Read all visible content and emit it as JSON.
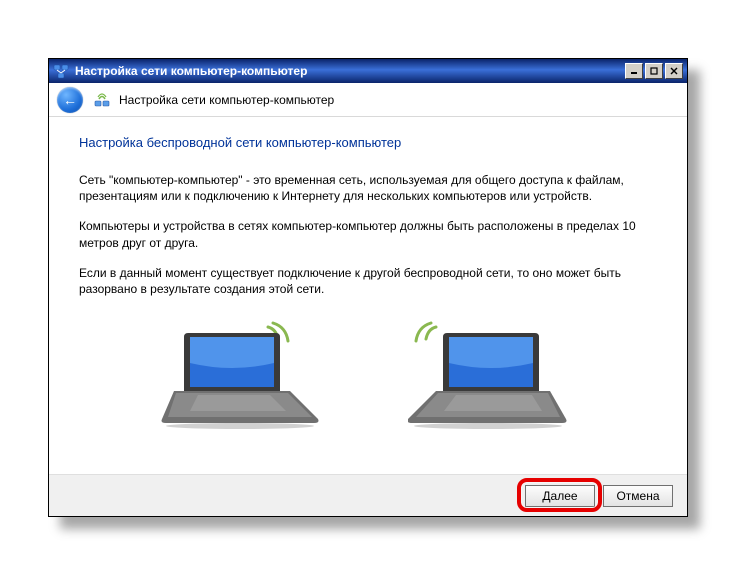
{
  "window": {
    "title": "Настройка сети компьютер-компьютер"
  },
  "subheader": {
    "title": "Настройка сети компьютер-компьютер"
  },
  "content": {
    "heading": "Настройка беспроводной сети компьютер-компьютер",
    "para1": "Сеть \"компьютер-компьютер\" - это временная сеть, используемая для общего доступа к файлам, презентациям или к подключению к Интернету для нескольких компьютеров или устройств.",
    "para2": "Компьютеры и устройства в сетях компьютер-компьютер должны быть расположены в пределах 10 метров друг от друга.",
    "para3": "Если в данный момент существует подключение к другой беспроводной сети, то оно может быть разорвано в результате создания этой сети."
  },
  "footer": {
    "next": "Далее",
    "cancel": "Отмена"
  }
}
